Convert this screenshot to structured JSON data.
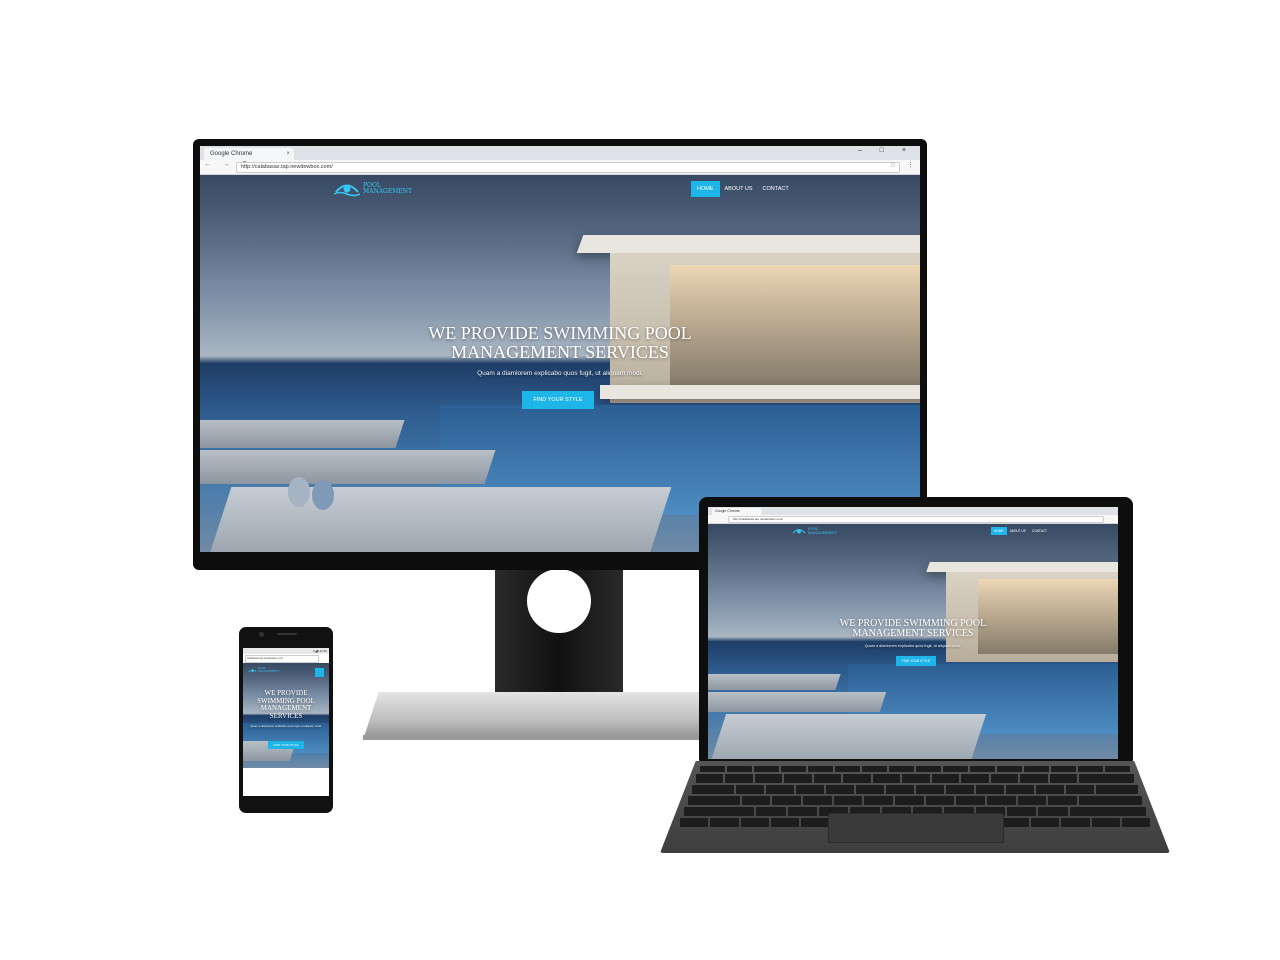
{
  "monitor": {
    "browser": {
      "tab_title": "Google Chrome",
      "tab_close": "×",
      "window_buttons": "– □ ×",
      "nav_buttons": "← → C",
      "url": "http://calabasas.tap.newdewbox.com/",
      "star": "☆",
      "menu": "⋮"
    },
    "site": {
      "logo_line1": "POOL",
      "logo_line2": "MANAGEMENT",
      "nav": [
        "HOME",
        "ABOUT US",
        "CONTACT"
      ],
      "active_nav": "HOME",
      "hero_title_line1": "WE PROVIDE SWIMMING POOL",
      "hero_title_line2": "MANAGEMENT SERVICES",
      "hero_subtitle": "Quam a diamlorem explicabo quos fugit, ut aliquam modi.",
      "cta_button": "FIND YOUR STYLE"
    }
  },
  "tablet": {
    "browser": {
      "tab_title": "Google Chrome",
      "url": "http://calabasas.tap.newdewbox.com/"
    },
    "site": {
      "logo_line1": "POOL",
      "logo_line2": "MANAGEMENT",
      "nav": [
        "HOME",
        "ABOUT US",
        "CONTACT"
      ],
      "hero_title_line1": "WE PROVIDE SWIMMING POOL",
      "hero_title_line2": "MANAGEMENT SERVICES",
      "hero_subtitle": "Quam a diamlorem explicabo quos fugit, ut aliquam modi.",
      "cta_button": "FIND YOUR STYLE"
    }
  },
  "phone": {
    "status": "▾◢▮ 12:30",
    "url": "calabasas.tap.newdewbox.com",
    "site": {
      "logo_line1": "POOL",
      "logo_line2": "MANAGEMENT",
      "hero_title_line1": "WE PROVIDE",
      "hero_title_line2": "SWIMMING POOL",
      "hero_title_line3": "MANAGEMENT",
      "hero_title_line4": "SERVICES",
      "hero_subtitle": "Quam a diamlorem explicabo quos fugit, ut aliquam modi.",
      "cta_button": "FIND YOUR STYLE"
    }
  },
  "colors": {
    "accent": "#1eb5e8",
    "logo": "#38c6f4"
  }
}
